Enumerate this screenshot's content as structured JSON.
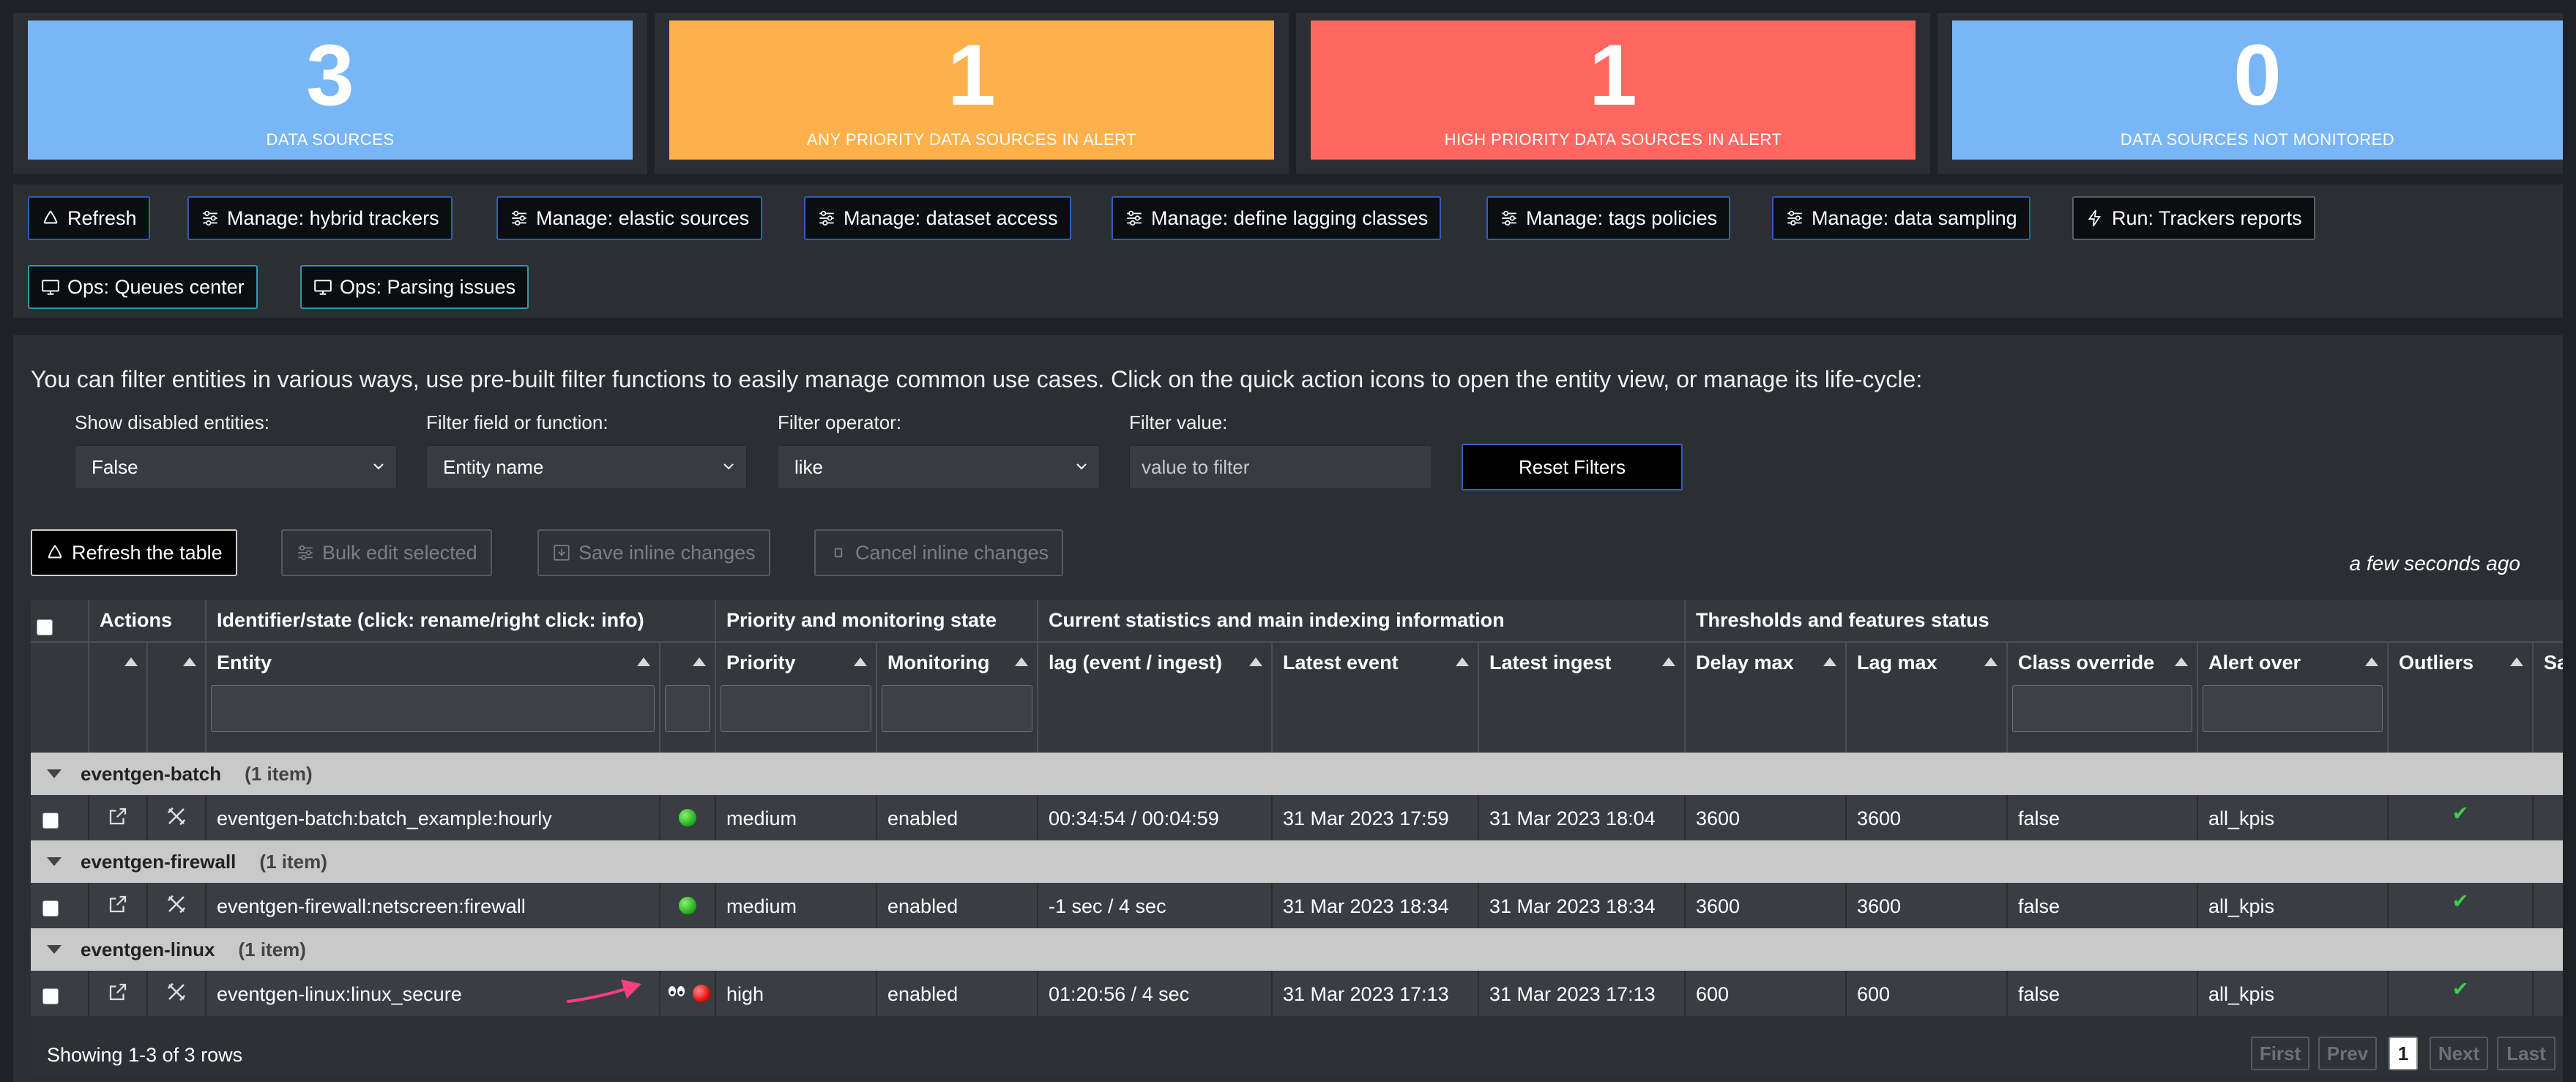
{
  "kpis": [
    {
      "value": "3",
      "label": "DATA SOURCES",
      "color": "#79b6f7"
    },
    {
      "value": "1",
      "label": "ANY PRIORITY DATA SOURCES IN ALERT",
      "color": "#feb14a"
    },
    {
      "value": "1",
      "label": "HIGH PRIORITY DATA SOURCES IN ALERT",
      "color": "#ff6760"
    },
    {
      "value": "0",
      "label": "DATA SOURCES NOT MONITORED",
      "color": "#79b6f7"
    }
  ],
  "toolbar": {
    "refresh": "Refresh",
    "hybrid": "Manage: hybrid trackers",
    "elastic": "Manage: elastic sources",
    "dataset": "Manage: dataset access",
    "lagging": "Manage: define lagging classes",
    "tags": "Manage: tags policies",
    "sampling": "Manage: data sampling",
    "reports": "Run: Trackers reports",
    "queues": "Ops: Queues center",
    "parsing": "Ops: Parsing issues"
  },
  "filters": {
    "intro": "You can filter entities in various ways, use pre-built filter functions to easily manage common use cases. Click on the quick action icons to open the entity view, or manage its life-cycle:",
    "disabled_label": "Show disabled entities:",
    "disabled_value": "False",
    "field_label": "Filter field or function:",
    "field_value": "Entity name",
    "operator_label": "Filter operator:",
    "operator_value": "like",
    "value_label": "Filter value:",
    "value_placeholder": "value to filter",
    "reset": "Reset Filters"
  },
  "actions": {
    "refresh_table": "Refresh the table",
    "bulk_edit": "Bulk edit selected",
    "save_inline": "Save inline changes",
    "cancel_inline": "Cancel inline changes",
    "updated": "a few seconds ago"
  },
  "table": {
    "groups": {
      "actions": "Actions",
      "identifier": "Identifier/state (click: rename/right click: info)",
      "priority": "Priority and monitoring state",
      "stats": "Current statistics and main indexing information",
      "thresholds": "Thresholds and features status"
    },
    "columns": {
      "entity": "Entity",
      "priority": "Priority",
      "monitoring": "Monitoring",
      "lag": "lag (event / ingest)",
      "latest_event": "Latest event",
      "latest_ingest": "Latest ingest",
      "delay_max": "Delay max",
      "lag_max": "Lag max",
      "class_override": "Class override",
      "alert_over": "Alert over",
      "outliers": "Outliers",
      "sampling": "Sa"
    },
    "rows": [
      {
        "group": "eventgen-batch",
        "count": "(1 item)",
        "entity": "eventgen-batch:batch_example:hourly",
        "state": "green",
        "priority": "medium",
        "monitoring": "enabled",
        "lag": "00:34:54 / 00:04:59",
        "latest_event": "31 Mar 2023 17:59",
        "latest_ingest": "31 Mar 2023 18:04",
        "delay_max": "3600",
        "lag_max": "3600",
        "class_override": "false",
        "alert_over": "all_kpis",
        "outliers": "✔"
      },
      {
        "group": "eventgen-firewall",
        "count": "(1 item)",
        "entity": "eventgen-firewall:netscreen:firewall",
        "state": "green",
        "priority": "medium",
        "monitoring": "enabled",
        "lag": "-1 sec / 4 sec",
        "latest_event": "31 Mar 2023 18:34",
        "latest_ingest": "31 Mar 2023 18:34",
        "delay_max": "3600",
        "lag_max": "3600",
        "class_override": "false",
        "alert_over": "all_kpis",
        "outliers": "✔"
      },
      {
        "group": "eventgen-linux",
        "count": "(1 item)",
        "entity": "eventgen-linux:linux_secure",
        "state": "red",
        "priority": "high",
        "monitoring": "enabled",
        "lag": "01:20:56 / 4 sec",
        "latest_event": "31 Mar 2023 17:13",
        "latest_ingest": "31 Mar 2023 17:13",
        "delay_max": "600",
        "lag_max": "600",
        "class_override": "false",
        "alert_over": "all_kpis",
        "outliers": "✔"
      }
    ],
    "footer": "Showing 1-3 of 3 rows",
    "pager": {
      "first": "First",
      "prev": "Prev",
      "page": "1",
      "next": "Next",
      "last": "Last"
    }
  }
}
